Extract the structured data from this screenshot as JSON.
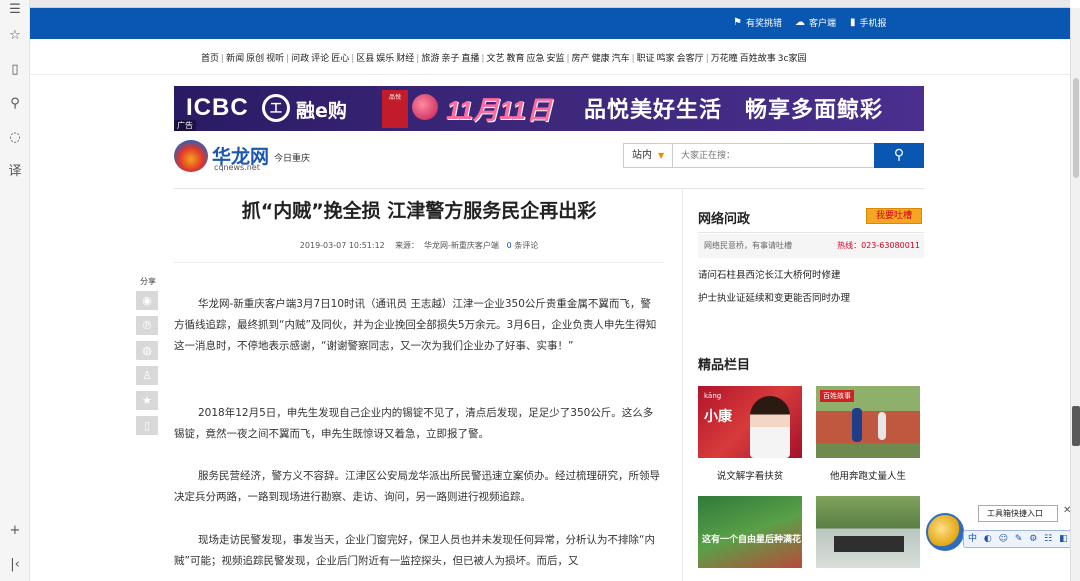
{
  "topbar": {
    "links": [
      "有奖挑错",
      "客户端",
      "手机报"
    ]
  },
  "nav": {
    "groups": [
      [
        "首页"
      ],
      [
        "新闻",
        "原创",
        "视听"
      ],
      [
        "问政",
        "评论",
        "匠心"
      ],
      [
        "区县",
        "娱乐",
        "财经"
      ],
      [
        "旅游",
        "亲子",
        "直播"
      ],
      [
        "文艺",
        "教育",
        "应急",
        "安监"
      ],
      [
        "房产",
        "健康",
        "汽车"
      ],
      [
        "职证",
        "鸣家",
        "会客厅"
      ],
      [
        "万花瞳",
        "百姓故事",
        "3c家园"
      ]
    ]
  },
  "banner": {
    "brand": "ICBC",
    "logo_char": "工",
    "product": "融e购",
    "box_text": "品悦",
    "date_text": "11月11日",
    "slogan": "品悦美好生活　畅享多面鲸彩",
    "ad_label": "广告"
  },
  "logo": {
    "name": "华龙网",
    "domain": "cqnews.net",
    "city": "今日重庆"
  },
  "search": {
    "scope": "站内",
    "placeholder": "大家正在搜："
  },
  "article": {
    "title": "抓“内贼”挽全损 江津警方服务民企再出彩",
    "datetime": "2019-03-07 10:51:12",
    "source_label": "来源：",
    "source": "华龙网-新重庆客户端",
    "comment_count": "0",
    "comment_label": "条评论",
    "paragraphs": [
      "华龙网-新重庆客户端3月7日10时讯（通讯员 王志越）江津一企业350公斤贵重金属不翼而飞，警方循线追踪，最终抓到“内贼”及同伙，并为企业挽回全部损失5万余元。3月6日，企业负责人申先生得知这一消息时，不停地表示感谢，“谢谢警察同志，又一次为我们企业办了好事、实事！”",
      "2018年12月5日，申先生发现自己企业内的锡锭不见了，清点后发现，足足少了350公斤。这么多锡锭，竟然一夜之间不翼而飞，申先生既惊讶又着急，立即报了警。",
      "服务民营经济，警方义不容辞。江津区公安局龙华派出所民警迅速立案侦办。经过梳理研究，所领导决定兵分两路，一路到现场进行勘察、走访、询问，另一路则进行视频追踪。",
      "现场走访民警发现，事发当天，企业门窗完好，保卫人员也并未发现任何异常，分析认为不排除“内贼”可能；视频追踪民警发现，企业后门附近有一监控探头，但已被人为损坏。而后，又"
    ]
  },
  "share": {
    "label": "分享"
  },
  "sidebar": {
    "wenzheng_title": "网络问政",
    "tucao_label": "我要吐槽",
    "intro": "网络民意桥，有事请吐槽",
    "hotline": "热线：023-63080011",
    "questions": [
      "请问石柱县西沱长江大桥何时修建",
      "护士执业证延续和变更能否同时办理"
    ],
    "jingpin_title": "精品栏目",
    "items": [
      {
        "caption": "说文解字看扶贫",
        "thumb_text": "小康",
        "thumb_sub": "kāng"
      },
      {
        "caption": "他用奔跑丈量人生",
        "thumb_text": "百姓故事"
      },
      {
        "caption": "",
        "thumb_text": "这有一个自由星后种满花"
      },
      {
        "caption": ""
      }
    ]
  },
  "toolbar": {
    "popup_label": "工具箱快捷入口",
    "icons": "中 ◐ ☺ ✎ ⚙ ☷ ◧"
  }
}
